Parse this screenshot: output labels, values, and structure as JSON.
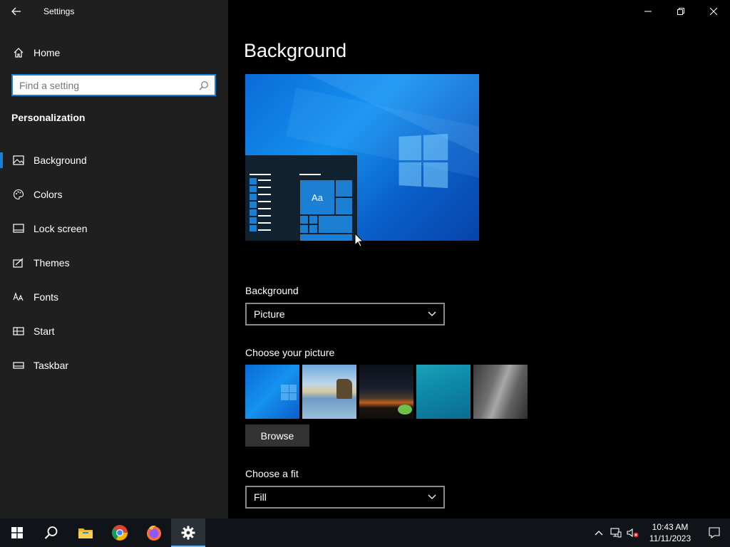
{
  "window": {
    "title": "Settings"
  },
  "sidebar": {
    "home_label": "Home",
    "search_placeholder": "Find a setting",
    "section_heading": "Personalization",
    "items": [
      {
        "label": "Background",
        "icon": "picture-icon",
        "selected": true
      },
      {
        "label": "Colors",
        "icon": "palette-icon",
        "selected": false
      },
      {
        "label": "Lock screen",
        "icon": "lock-screen-icon",
        "selected": false
      },
      {
        "label": "Themes",
        "icon": "themes-icon",
        "selected": false
      },
      {
        "label": "Fonts",
        "icon": "fonts-icon",
        "selected": false
      },
      {
        "label": "Start",
        "icon": "start-icon",
        "selected": false
      },
      {
        "label": "Taskbar",
        "icon": "taskbar-icon",
        "selected": false
      }
    ]
  },
  "main": {
    "page_title": "Background",
    "preview": {
      "tile_label": "Aa"
    },
    "background_label": "Background",
    "background_value": "Picture",
    "choose_picture_label": "Choose your picture",
    "browse_label": "Browse",
    "choose_fit_label": "Choose a fit",
    "fit_value": "Fill"
  },
  "taskbar": {
    "apps": [
      "start-icon",
      "search-icon",
      "file-explorer-icon",
      "chrome-icon",
      "firefox-icon",
      "settings-icon"
    ],
    "time": "10:43 AM",
    "date": "11/11/2023"
  },
  "colors": {
    "accent": "#1b7fd4",
    "sidebar_bg": "#1f1f1f",
    "main_bg": "#000000",
    "taskbar_bg": "#101418"
  }
}
